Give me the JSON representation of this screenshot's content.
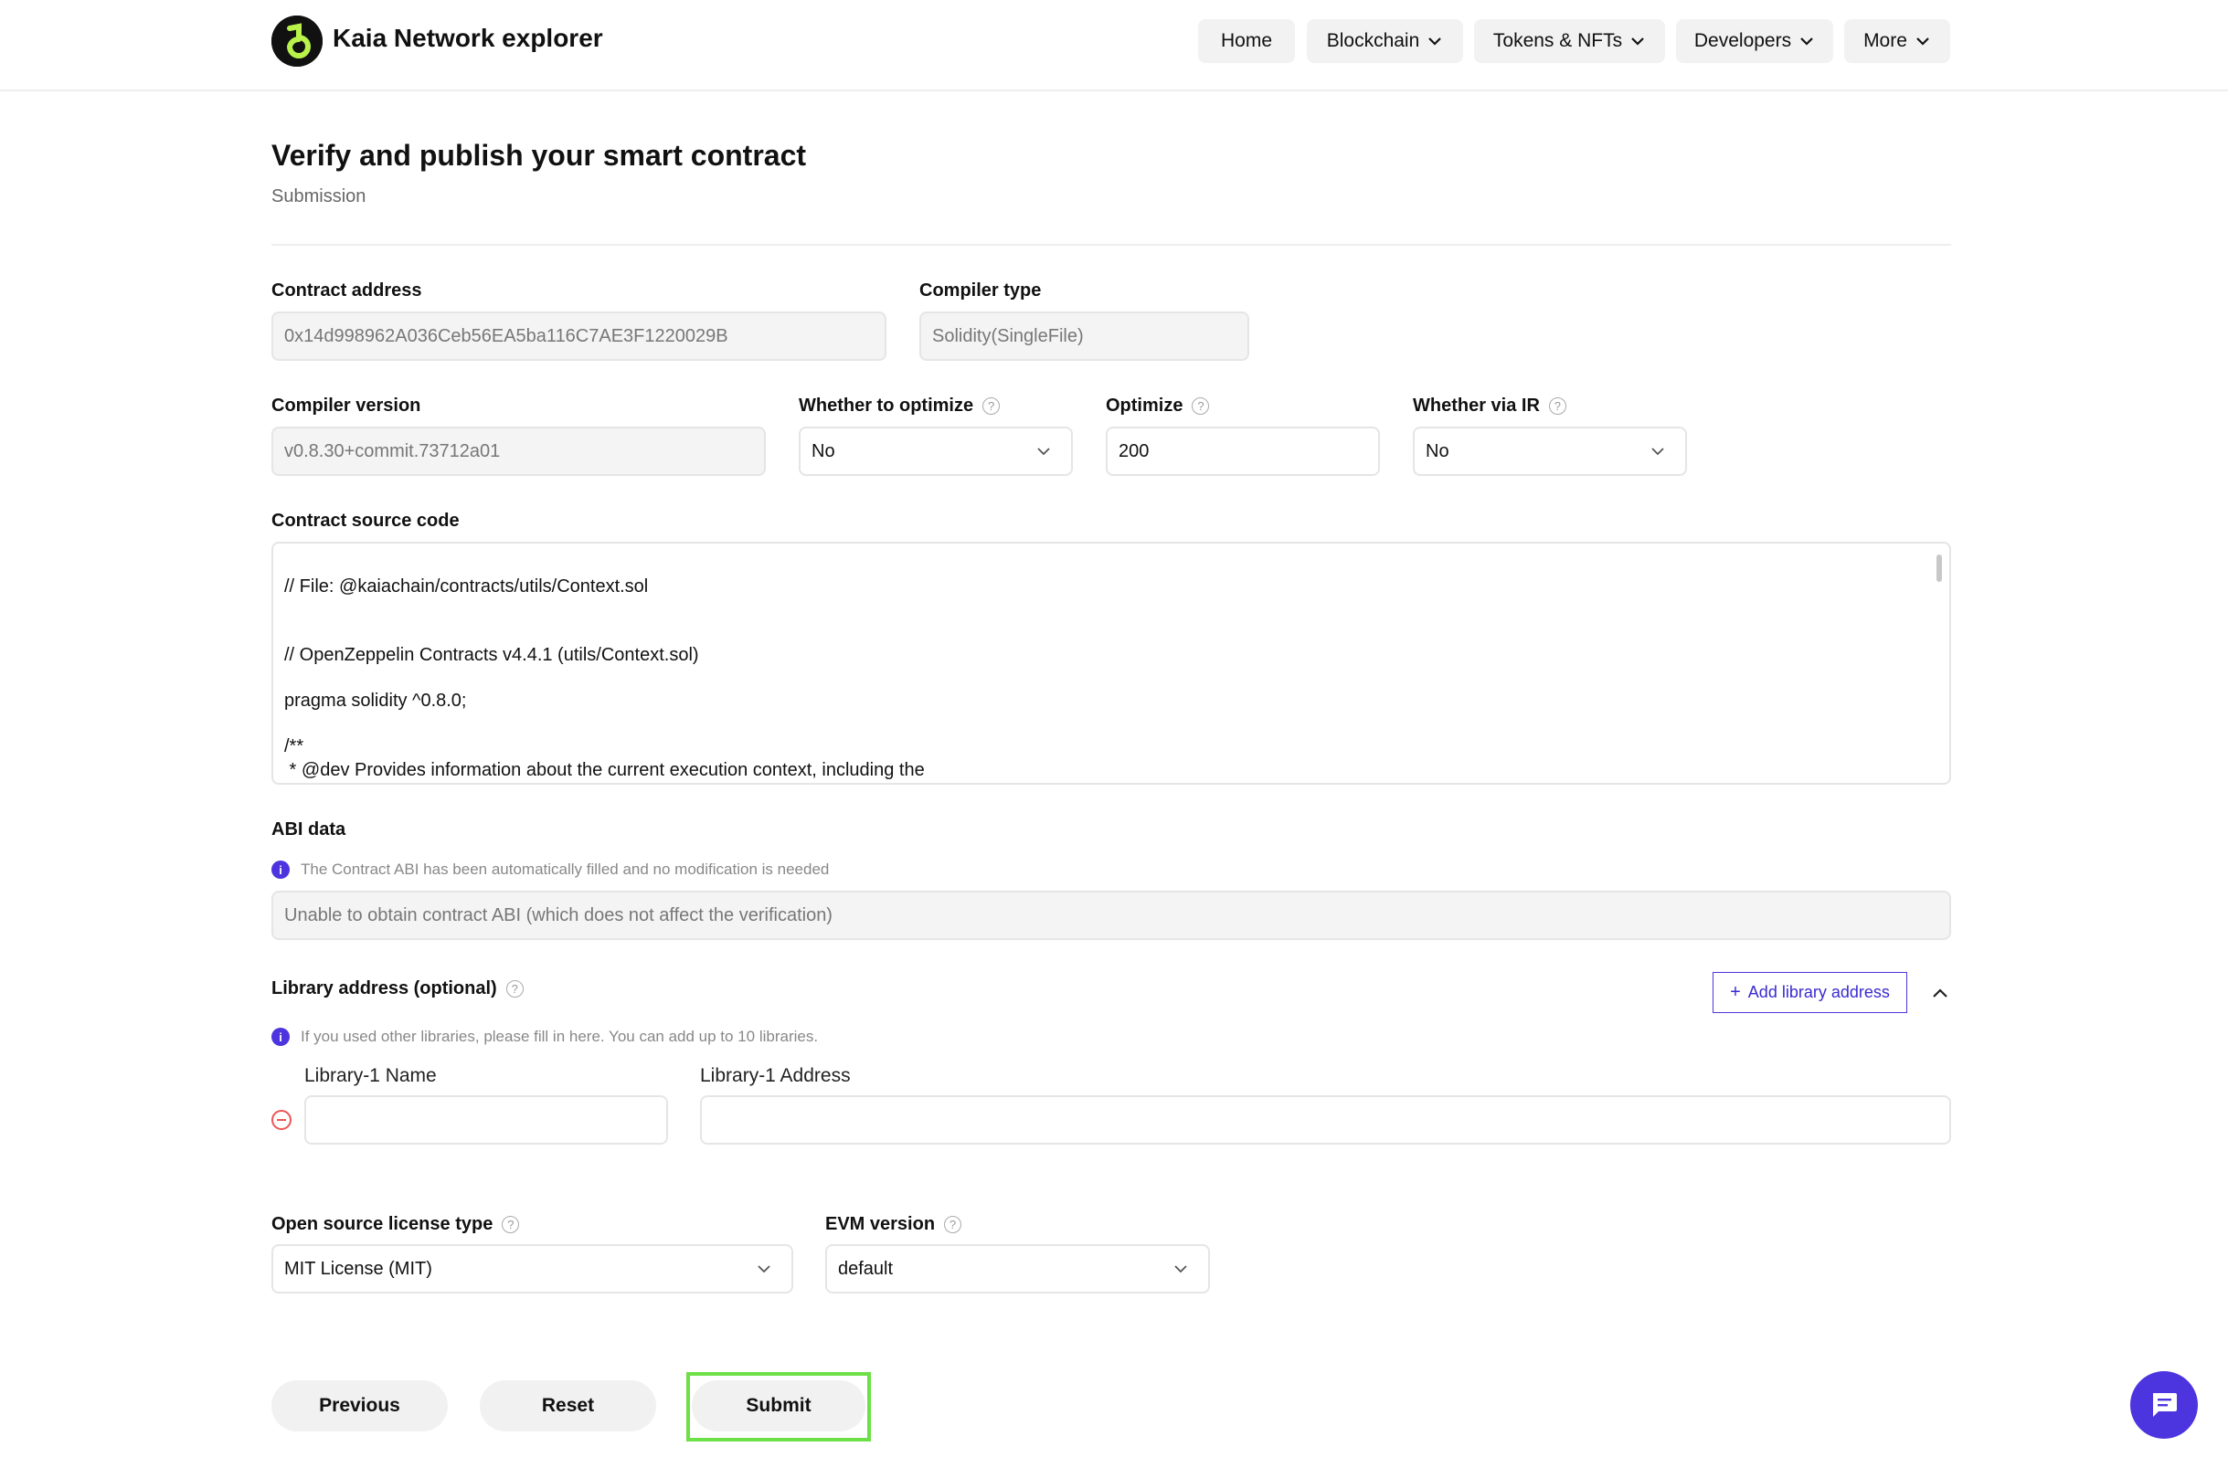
{
  "header": {
    "brand": "Kaia Network explorer",
    "nav": [
      "Home",
      "Blockchain",
      "Tokens & NFTs",
      "Developers",
      "More"
    ]
  },
  "page": {
    "title": "Verify and publish your smart contract",
    "subtitle": "Submission"
  },
  "form": {
    "contract_address": {
      "label": "Contract address",
      "value": "0x14d998962A036Ceb56EA5ba116C7AE3F1220029B"
    },
    "compiler_type": {
      "label": "Compiler type",
      "value": "Solidity(SingleFile)"
    },
    "compiler_version": {
      "label": "Compiler version",
      "value": "v0.8.30+commit.73712a01"
    },
    "whether_to_optimize": {
      "label": "Whether to optimize",
      "value": "No"
    },
    "optimize": {
      "label": "Optimize",
      "value": "200"
    },
    "whether_via_ir": {
      "label": "Whether via IR",
      "value": "No"
    },
    "source_code": {
      "label": "Contract source code",
      "lines": [
        "// File: @kaiachain/contracts/utils/Context.sol",
        "// OpenZeppelin Contracts v4.4.1 (utils/Context.sol)",
        "pragma solidity ^0.8.0;",
        "/**",
        " * @dev Provides information about the current execution context, including the"
      ]
    },
    "abi": {
      "label": "ABI data",
      "info": "The Contract ABI has been automatically filled and no modification is needed",
      "value": "Unable to obtain contract ABI (which does not affect the verification)"
    },
    "library": {
      "label": "Library address (optional)",
      "add_button": "Add library address",
      "info": "If you used other libraries, please fill in here. You can add up to 10 libraries.",
      "name_label": "Library-1 Name",
      "address_label": "Library-1 Address"
    },
    "license": {
      "label": "Open source license type",
      "value": "MIT License (MIT)"
    },
    "evm_version": {
      "label": "EVM version",
      "value": "default"
    }
  },
  "buttons": {
    "previous": "Previous",
    "reset": "Reset",
    "submit": "Submit"
  },
  "colors": {
    "accent": "#4c35de",
    "highlight": "#6de047"
  },
  "icons": {
    "logo": "kaia-logo",
    "chat": "chat-icon"
  }
}
